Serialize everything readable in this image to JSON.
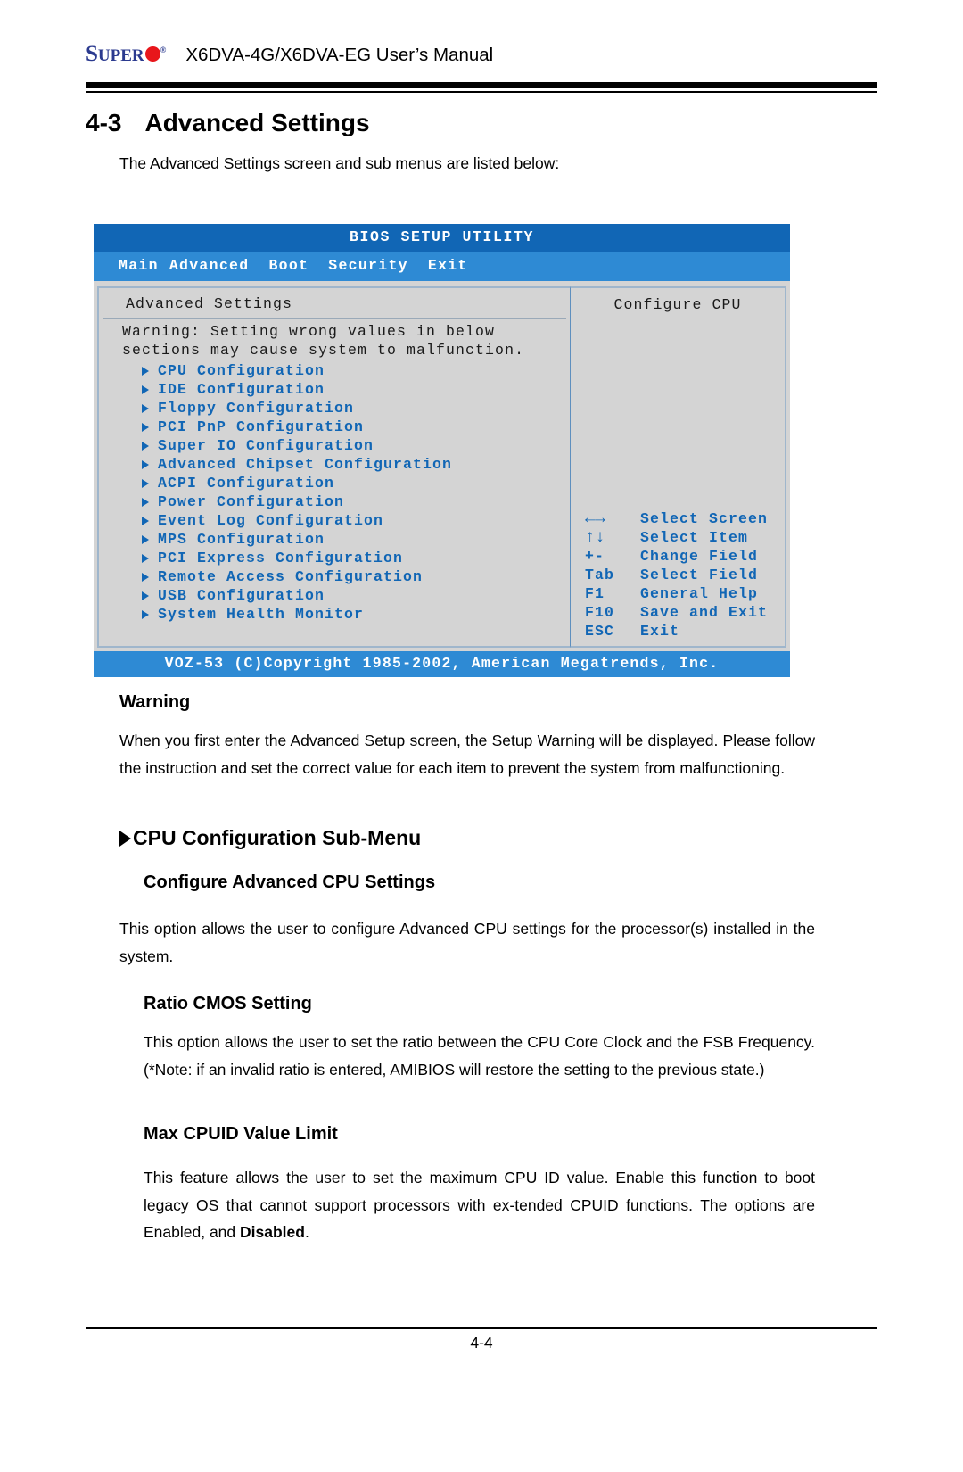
{
  "header": {
    "logo_main": "S",
    "logo_rest": "UPER",
    "logo_tm": "®",
    "title": "X6DVA-4G/X6DVA-EG User’s Manual"
  },
  "section": {
    "number": "4-3",
    "title": "Advanced Settings",
    "intro": "The Advanced Settings screen and sub menus are listed below:"
  },
  "bios": {
    "title": "BIOS SETUP UTILITY",
    "menu": [
      "Main",
      "Advanced",
      "Boot",
      "Security",
      "Exit"
    ],
    "left_panel_title": "Advanced Settings",
    "warning_line1": "Warning: Setting wrong values in below",
    "warning_line2": "sections may cause system to malfunction.",
    "items": [
      "CPU Configuration",
      "IDE Configuration",
      "Floppy Configuration",
      "PCI PnP Configuration",
      "Super IO Configuration",
      "Advanced Chipset Configuration",
      "ACPI Configuration",
      "Power Configuration",
      "Event Log Configuration",
      "MPS Configuration",
      "PCI Express Configuration",
      "Remote Access Configuration",
      "USB Configuration",
      "System Health Monitor"
    ],
    "right_panel_title": "Configure CPU",
    "keys": [
      {
        "key": "←→",
        "desc": "Select Screen",
        "glyph": true
      },
      {
        "key": "↑↓",
        "desc": "Select Item",
        "glyph": true
      },
      {
        "key": "+-",
        "desc": "Change Field",
        "glyph": false
      },
      {
        "key": "Tab",
        "desc": "Select Field",
        "glyph": false
      },
      {
        "key": "F1",
        "desc": "General Help",
        "glyph": false
      },
      {
        "key": "F10",
        "desc": "Save and Exit",
        "glyph": false
      },
      {
        "key": "ESC",
        "desc": "Exit",
        "glyph": false
      }
    ],
    "footer": "VOZ-53 (C)Copyright 1985-2002, American Megatrends, Inc."
  },
  "content": {
    "warning_heading": "Warning",
    "warning_body": "When you first enter the Advanced Setup screen, the Setup Warning will be displayed. Please follow the instruction and set the correct value for each item to prevent the system from malfunctioning.",
    "cpu_submenu_heading": "CPU Configuration Sub-Menu",
    "configure_heading": "Configure Advanced CPU Settings",
    "configure_body": "This option allows the user to configure Advanced CPU settings for the processor(s) installed in the system.",
    "ratio_heading": "Ratio CMOS Setting",
    "ratio_body": "This option allows the user to set the ratio between the CPU Core Clock and the FSB Frequency. (*Note: if an invalid ratio is entered, AMIBIOS will restore the setting to the previous state.)",
    "cpuid_heading": "Max CPUID Value Limit",
    "cpuid_body_part1": "This feature allows the user to set the maximum CPU ID value. Enable this function to boot legacy OS that cannot support processors with ex-tended CPUID functions. The options are Enabled, and ",
    "cpuid_body_bold": "Disabled",
    "cpuid_body_part2": "."
  },
  "footer": {
    "page_number": "4-4"
  },
  "colors": {
    "brand_blue": "#2b3a8f",
    "brand_red": "#e8161b",
    "bios_title_blue": "#1166b5",
    "bios_menu_blue": "#2e8ad4",
    "bios_body_gray": "#d4d4d4",
    "bios_link_blue": "#1166b5"
  }
}
